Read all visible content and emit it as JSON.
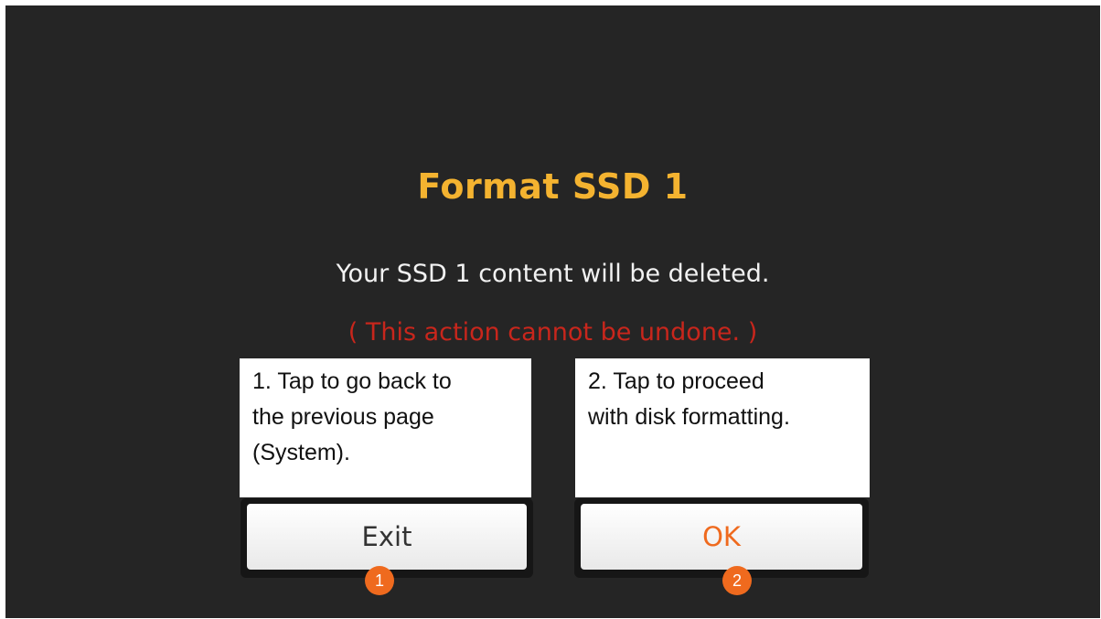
{
  "dialog": {
    "title": "Format SSD 1",
    "message": "Your SSD 1 content will be deleted.",
    "warning": "( This action cannot be undone. )",
    "colors": {
      "background": "#252525",
      "title": "#f4b330",
      "warning": "#c8261c",
      "ok_text": "#ef6a1e",
      "badge": "#ef6a1e"
    }
  },
  "buttons": {
    "exit_label": "Exit",
    "ok_label": "OK"
  },
  "callouts": {
    "exit": "1. Tap to go back to\nthe previous page\n(System).",
    "ok": "2. Tap to proceed\nwith disk formatting."
  },
  "badges": {
    "exit": "1",
    "ok": "2"
  }
}
